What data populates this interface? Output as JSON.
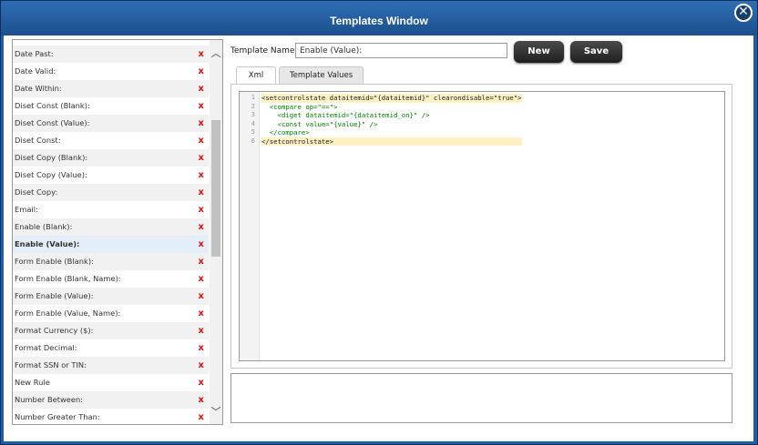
{
  "window": {
    "title": "Templates Window"
  },
  "list": {
    "items": [
      {
        "label": "Date Past:"
      },
      {
        "label": "Date Valid:"
      },
      {
        "label": "Date Within:"
      },
      {
        "label": "Diset Const (Blank):"
      },
      {
        "label": "Diset Const (Value):"
      },
      {
        "label": "Diset Const:"
      },
      {
        "label": "Diset Copy (Blank):"
      },
      {
        "label": "Diset Copy (Value):"
      },
      {
        "label": "Diset Copy:"
      },
      {
        "label": "Email:"
      },
      {
        "label": "Enable (Blank):"
      },
      {
        "label": "Enable (Value):",
        "selected": true
      },
      {
        "label": "Form Enable (Blank):"
      },
      {
        "label": "Form Enable (Blank, Name):"
      },
      {
        "label": "Form Enable (Value):"
      },
      {
        "label": "Form Enable (Value, Name):"
      },
      {
        "label": "Format Currency ($):"
      },
      {
        "label": "Format Decimal:"
      },
      {
        "label": "Format SSN or TIN:"
      },
      {
        "label": "New Rule"
      },
      {
        "label": "Number Between:"
      },
      {
        "label": "Number Greater Than:"
      }
    ],
    "delete_glyph": "x"
  },
  "form": {
    "template_name_label": "Template Name:",
    "template_name_value": "Enable (Value):",
    "new_label": "New",
    "save_label": "Save"
  },
  "tabs": [
    {
      "label": "Xml",
      "active": true
    },
    {
      "label": "Template Values",
      "active": false
    }
  ],
  "editor": {
    "line_numbers": [
      "1",
      "2",
      "3",
      "4",
      "5",
      "6"
    ],
    "lines": [
      "<setcontrolstate dataitemid=\"{dataitemid}\" clearondisable=\"true\">",
      "  <compare op=\"==\">",
      "    <diget dataitemid=\"{dataitemid_on}\" />",
      "    <const value=\"{value}\" />",
      "  </compare>",
      "</setcontrolstate>"
    ]
  },
  "colors": {
    "titlebar": "#1d5fa6",
    "delete_x": "#d11111",
    "selected_row": "#e3eef8"
  },
  "icons": {
    "close": "close-icon",
    "scroll_up": "chevron-up-icon",
    "scroll_down": "chevron-down-icon"
  }
}
